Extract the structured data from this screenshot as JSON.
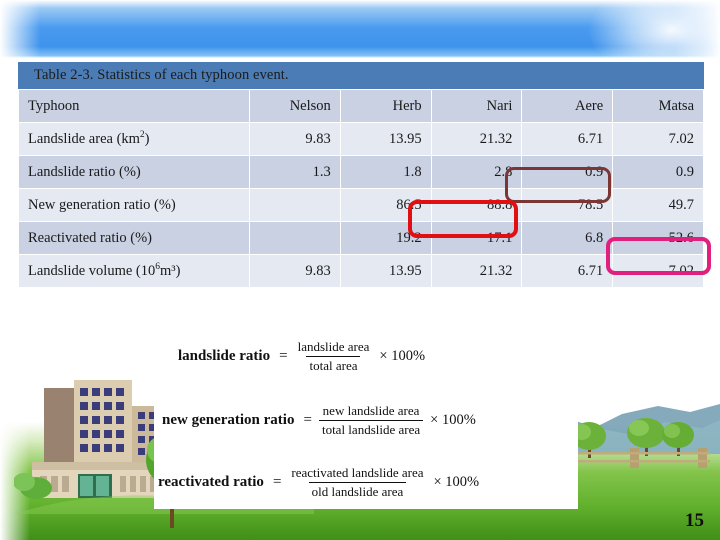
{
  "slide": {
    "page_number": "15"
  },
  "table": {
    "caption": "Table 2-3. Statistics of each typhoon event.",
    "header": {
      "row_label": "Typhoon",
      "columns": [
        "Nelson",
        "Herb",
        "Nari",
        "Aere",
        "Matsa"
      ]
    },
    "rows": [
      {
        "label_main": "Landslide area (km",
        "label_sup": "2",
        "label_tail": ")",
        "values": [
          "9.83",
          "13.95",
          "21.32",
          "6.71",
          "7.02"
        ]
      },
      {
        "label_main": "Landslide ratio (%)",
        "label_sup": "",
        "label_tail": "",
        "values": [
          "1.3",
          "1.8",
          "2.8",
          "0.9",
          "0.9"
        ]
      },
      {
        "label_main": "New generation ratio (%)",
        "label_sup": "",
        "label_tail": "",
        "values": [
          "",
          "86.5",
          "88.8",
          "78.5",
          "49.7"
        ]
      },
      {
        "label_main": "Reactivated ratio (%)",
        "label_sup": "",
        "label_tail": "",
        "values": [
          "",
          "19.2",
          "17.1",
          "6.8",
          "52.6"
        ]
      },
      {
        "label_main": "Landslide volume (10",
        "label_sup": "6",
        "label_tail": "m³)",
        "values": [
          "9.83",
          "13.95",
          "21.32",
          "6.71",
          "7.02"
        ]
      }
    ]
  },
  "annotations": [
    {
      "name": "highlight-aere-landslide-ratio",
      "color": "#7b3535",
      "value": "0.9"
    },
    {
      "name": "highlight-nari-new-generation-ratio",
      "color": "#e10f12",
      "value": "88.8"
    },
    {
      "name": "highlight-matsa-reactivated-ratio",
      "color": "#e01f7e",
      "value": "52.6"
    }
  ],
  "formulas": [
    {
      "name": "landslide ratio",
      "equals": "=",
      "numerator": "landslide area",
      "denominator": "total area",
      "tail": "× 100%"
    },
    {
      "name": "new generation ratio",
      "equals": "=",
      "numerator": "new landslide area",
      "denominator": "total landslide area",
      "tail": "× 100%"
    },
    {
      "name": "reactivated ratio",
      "equals": "=",
      "numerator": "reactivated landslide area",
      "denominator": "old landslide area",
      "tail": "× 100%"
    }
  ],
  "colors": {
    "caption_bar": "#4b7cb5",
    "row_band_dark": "#c9d1e2",
    "row_band_light": "#e4e9f2",
    "sky": "#4a9bef",
    "grass": "#63b22e"
  }
}
